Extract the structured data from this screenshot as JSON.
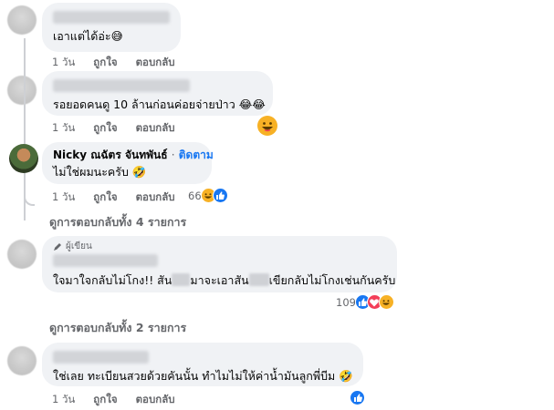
{
  "comments": [
    {
      "text": "เอาแต่ได้อ่ะ😅",
      "time": "1 วัน",
      "like": "ถูกใจ",
      "reply": "ตอบกลับ"
    },
    {
      "text": "รอยอดคนดู 10 ล้านก่อนค่อยจ่ายป่าว 😂😂",
      "time": "1 วัน",
      "like": "ถูกใจ",
      "reply": "ตอบกลับ"
    },
    {
      "name": "Nicky ณฉัตร จันทพันธ์",
      "separator": "·",
      "follow": "ติดตาม",
      "text": "ไม่ใช่ผมนะครับ 🤣",
      "time": "1 วัน",
      "like": "ถูกใจ",
      "reply": "ตอบกลับ",
      "reaction_count": "66"
    },
    {
      "badge": "ผู้เขียน",
      "text_a": "ใจมาใจกลับไม่โกง!! สัน",
      "text_b": "มาจะเอาสัน",
      "text_c": "เขียกลับไม่โกงเช่นกันครับ",
      "reaction_count": "109"
    },
    {
      "text": "ใช่เลย ทะเบียนสวยด้วยคันนั้น ทำไมไม่ให้ค่าน้ำมันลูกพี่บีม 🤣",
      "time": "1 วัน",
      "like": "ถูกใจ",
      "reply": "ตอบกลับ"
    }
  ],
  "view_replies": [
    {
      "label": "ดูการตอบกลับทั้ง 4 รายการ"
    },
    {
      "label": "ดูการตอบกลับทั้ง 2 รายการ"
    }
  ],
  "icons": {
    "reaction_haha": "haha-emoji-icon",
    "reaction_love": "love-emoji-icon",
    "reaction_like": "like-thumb-icon",
    "author_badge": "pen-icon"
  },
  "colors": {
    "bubble": "#f0f2f5",
    "meta_text": "#65676b",
    "link_blue": "#1877f2",
    "haha": "#f7b125",
    "love": "#f33e58"
  }
}
